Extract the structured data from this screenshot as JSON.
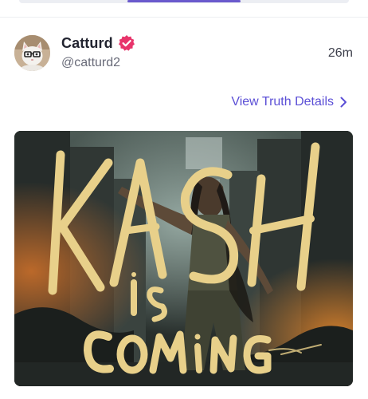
{
  "post": {
    "author": {
      "display_name": "Catturd",
      "handle": "@catturd2",
      "verified": true,
      "avatar_icon": "cat-with-glasses-avatar",
      "verified_icon": "verified-badge-icon",
      "verified_color": "#e8346b"
    },
    "timestamp": "26m",
    "details_link": {
      "label": "View Truth Details",
      "icon": "chevron-right-icon",
      "color": "#5b4fd6"
    },
    "image": {
      "text_line1": "KASH",
      "text_line2": "is",
      "text_line3": "COMiNG"
    }
  }
}
